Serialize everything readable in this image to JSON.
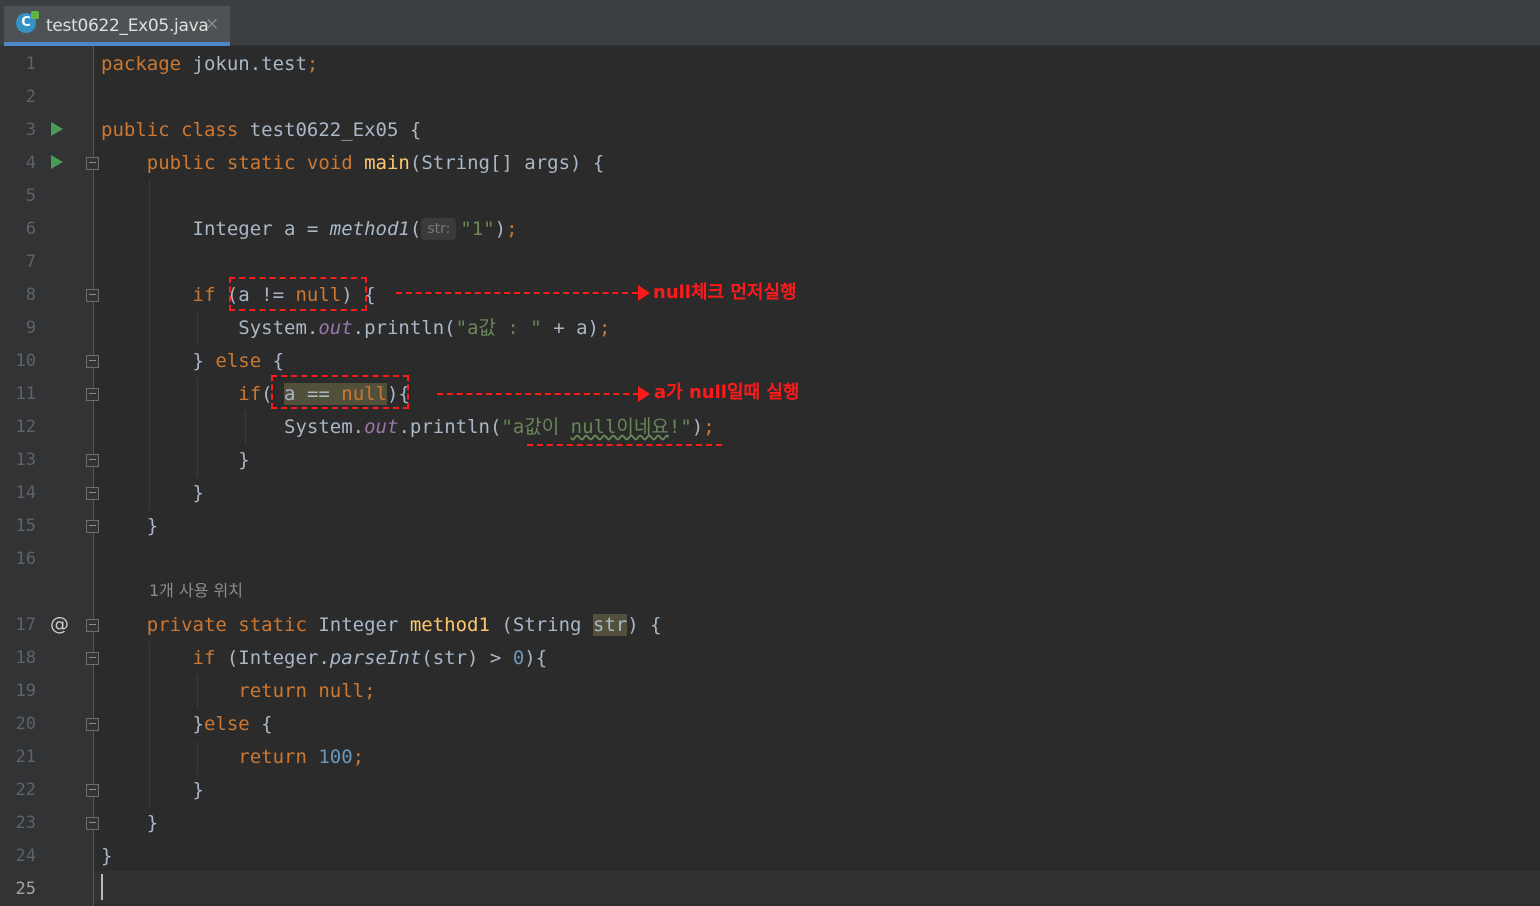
{
  "tab": {
    "icon_letter": "C",
    "filename": "test0622_Ex05.java",
    "close_glyph": "×"
  },
  "line_numbers": [
    "1",
    "2",
    "3",
    "4",
    "5",
    "6",
    "7",
    "8",
    "9",
    "10",
    "11",
    "12",
    "13",
    "14",
    "15",
    "16",
    "17",
    "18",
    "19",
    "20",
    "21",
    "22",
    "23",
    "24",
    "25"
  ],
  "gutter": {
    "override_marker": "@"
  },
  "code": {
    "l1": {
      "kw": "package",
      "rest": " jokun.test",
      "semi": ";"
    },
    "l3": {
      "kw": "public class",
      "name": " test0622_Ex05 {"
    },
    "l4": {
      "kw": "    public static void ",
      "fn": "main",
      "rest": "(String[] args) {"
    },
    "l6": {
      "pre": "        Integer a = ",
      "call": "method1",
      "open": "(",
      "hint": "str:",
      "arg": "\"1\"",
      "close": ")",
      "semi": ";"
    },
    "l8": {
      "kw": "        if ",
      "cond_a": "(a != ",
      "cond_null": "null",
      "cond_b": ")",
      "rest": " {"
    },
    "l9": {
      "pre": "            System.",
      "field": "out",
      "rest": ".println(",
      "str": "\"a값 : \"",
      "tail": " + a)",
      "semi": ";"
    },
    "l10": {
      "pre": "        } ",
      "kw": "else",
      "rest": " {"
    },
    "l11": {
      "kw": "            if",
      "open": "( ",
      "var": "a",
      "op": " == ",
      "null": "null",
      "close": "){"
    },
    "l12": {
      "pre": "                System.",
      "field": "out",
      "rest": ".println(",
      "str_a": "\"a값이 ",
      "str_b": "null이네요",
      "str_c": "!\"",
      "tail": ")",
      "semi": ";"
    },
    "l13": {
      "text": "            }"
    },
    "l14": {
      "text": "        }"
    },
    "l15": {
      "text": "    }"
    },
    "usage_hint": "1개 사용 위치",
    "l17": {
      "kw1": "    private static ",
      "type": "Integer ",
      "fn": "method1",
      "rest": " (String ",
      "param": "str",
      "tail": ") {"
    },
    "l18": {
      "kw": "        if",
      "pre": " (Integer.",
      "call": "parseInt",
      "mid": "(str) > ",
      "num": "0",
      "tail": "){"
    },
    "l19": {
      "kw": "            return null",
      "semi": ";"
    },
    "l20": {
      "pre": "        }",
      "kw": "else",
      "rest": " {"
    },
    "l21": {
      "kw": "            return ",
      "num": "100",
      "semi": ";"
    },
    "l22": {
      "text": "        }"
    },
    "l23": {
      "text": "    }"
    },
    "l24": {
      "text": "}"
    }
  },
  "annotations": {
    "note1": "null체크 먼저실행",
    "note2": "a가 null일때 실행"
  },
  "colors": {
    "background": "#2b2b2b",
    "keyword": "#cc7832",
    "string": "#6a8759",
    "number": "#6897bb",
    "annotation": "#ff1a1a"
  }
}
